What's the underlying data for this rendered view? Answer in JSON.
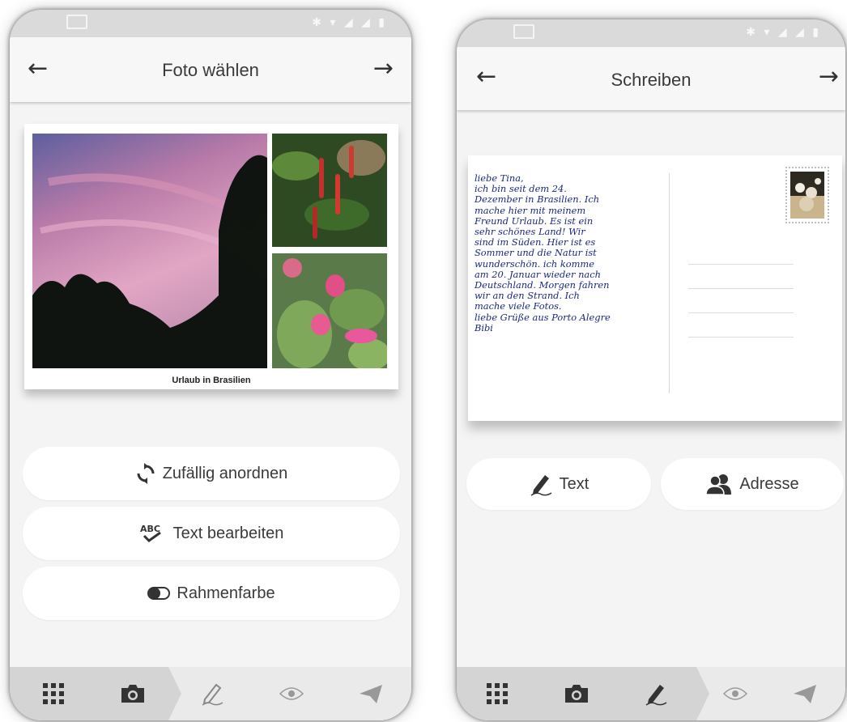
{
  "left_screen": {
    "title": "Foto wählen",
    "back_icon": "arrow-left-icon",
    "forward_icon": "arrow-right-icon",
    "collage_caption": "Urlaub in Brasilien",
    "buttons": [
      {
        "label": "Zufällig anordnen",
        "icon": "shuffle-icon"
      },
      {
        "label": "Text bearbeiten",
        "icon": "spellcheck-icon"
      },
      {
        "label": "Rahmenfarbe",
        "icon": "toggle-icon"
      }
    ],
    "bottom_nav": [
      "grid-icon",
      "camera-icon",
      "pen-icon",
      "eye-icon",
      "send-icon"
    ],
    "active_nav": "camera-icon"
  },
  "right_screen": {
    "title": "Schreiben",
    "back_icon": "arrow-left-icon",
    "forward_icon": "arrow-right-icon",
    "postcard_text": "liebe Tina,\nich bin seit dem 24.\nDezember in Brasilien. Ich\nmache hier mit meinem\nFreund Urlaub. Es ist ein\nsehr schönes Land! Wir\nsind im Süden. Hier ist es\nSommer und die Natur ist\nwunderschön. ich komme\nam 20. Januar wieder nach\nDeutschland. Morgen fahren\nwir an den Strand. Ich\nmache viele Fotos.\nliebe Grüße aus Porto Alegre\nBibi",
    "buttons": [
      {
        "label": "Text",
        "icon": "pen-icon"
      },
      {
        "label": "Adresse",
        "icon": "contacts-icon"
      }
    ],
    "bottom_nav": [
      "grid-icon",
      "camera-icon",
      "pen-icon",
      "eye-icon",
      "send-icon"
    ],
    "active_nav": "pen-icon"
  },
  "colors": {
    "background": "#f4f4f4",
    "handwriting": "#1b2880",
    "nav_bar": "#eaeaea",
    "nav_active": "#d4d4d4"
  }
}
